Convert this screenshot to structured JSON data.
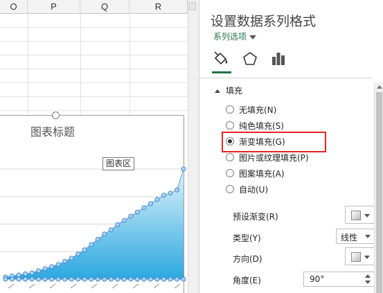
{
  "sheet": {
    "columns": [
      "O",
      "P",
      "Q",
      "R"
    ]
  },
  "chart": {
    "title": "图表标题",
    "tooltip": "图表区"
  },
  "chart_data": {
    "type": "area",
    "title": "图表标题",
    "values": [
      2,
      3,
      4,
      5,
      6,
      8,
      10,
      12,
      14,
      17,
      20,
      24,
      28,
      33,
      38,
      43,
      47,
      52,
      56,
      60,
      64,
      68,
      72,
      76,
      80,
      82,
      85,
      105
    ],
    "secondary_values": [
      0,
      0,
      0,
      0,
      0,
      0,
      0,
      0,
      0,
      0,
      0,
      0,
      0,
      0,
      0,
      0,
      0,
      0,
      0,
      0,
      0,
      0,
      0,
      0,
      0,
      0,
      0,
      0
    ],
    "fill": "gradient",
    "colors": {
      "area_top": "#dff2fb",
      "area_bottom": "#2ba8e0",
      "line": "#5b9bd5",
      "marker_fill": "#a9d4f5",
      "marker_stroke": "#4a86c8"
    }
  },
  "pane": {
    "title": "设置数据系列格式",
    "options_label": "系列选项",
    "tabs": [
      {
        "name": "fill-line",
        "icon": "paint-bucket-icon"
      },
      {
        "name": "effects",
        "icon": "pentagon-icon"
      },
      {
        "name": "series-options",
        "icon": "bar-chart-icon"
      }
    ],
    "section_title": "填充",
    "fill_options": [
      {
        "label": "无填充(N)",
        "selected": false
      },
      {
        "label": "纯色填充(S)",
        "selected": false
      },
      {
        "label": "渐变填充(G)",
        "selected": true
      },
      {
        "label": "图片或纹理填充(P)",
        "selected": false
      },
      {
        "label": "图案填充(A)",
        "selected": false
      },
      {
        "label": "自动(U)",
        "selected": false
      }
    ],
    "props": {
      "preset_label": "预设渐变(R)",
      "type_label": "类型(Y)",
      "type_value": "线性",
      "direction_label": "方向(D)",
      "angle_label": "角度(E)",
      "angle_value": "90°"
    }
  },
  "colors": {
    "accent": "#217346",
    "highlight": "#e52222"
  }
}
